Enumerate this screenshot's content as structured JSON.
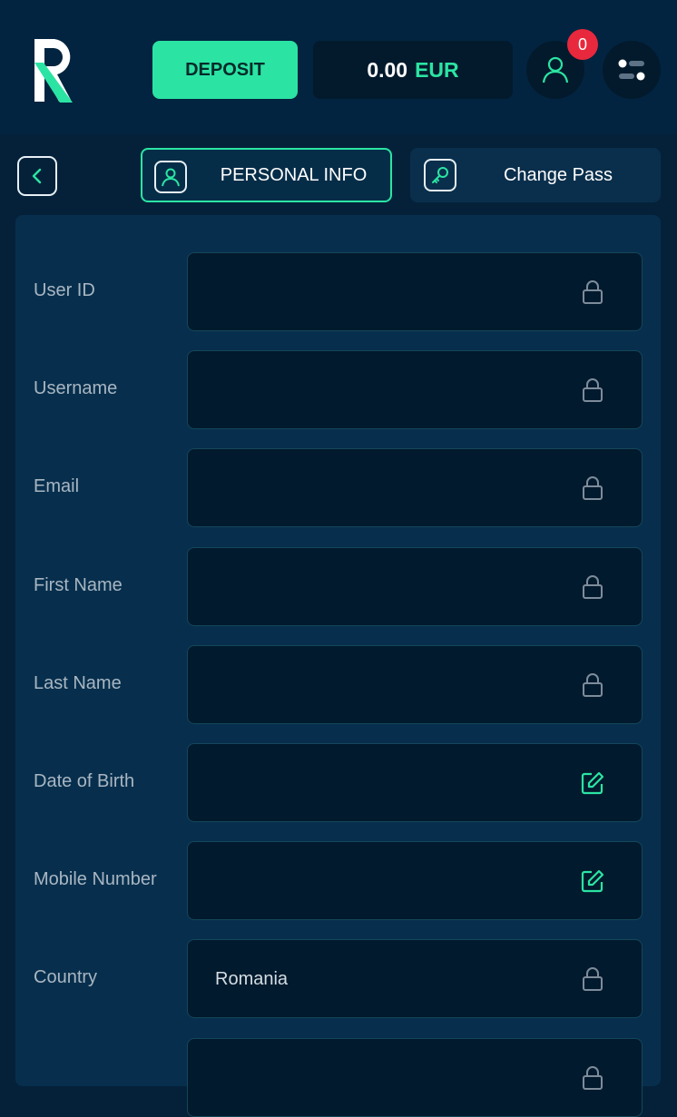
{
  "header": {
    "deposit_label": "DEPOSIT",
    "balance_amount": "0.00",
    "balance_currency": "EUR",
    "notification_count": "0"
  },
  "tabs": [
    {
      "label": "PERSONAL INFO",
      "active": true,
      "icon": "user-card-icon"
    },
    {
      "label": "Change Pass",
      "active": false,
      "icon": "key-icon"
    }
  ],
  "fields": [
    {
      "label": "User ID",
      "value": "",
      "icon": "lock-icon"
    },
    {
      "label": "Username",
      "value": "",
      "icon": "lock-icon"
    },
    {
      "label": "Email",
      "value": "",
      "icon": "lock-icon"
    },
    {
      "label": "First Name",
      "value": "",
      "icon": "lock-icon"
    },
    {
      "label": "Last Name",
      "value": "",
      "icon": "lock-icon"
    },
    {
      "label": "Date of Birth",
      "value": "",
      "icon": "edit-icon"
    },
    {
      "label": "Mobile Number",
      "value": "",
      "icon": "edit-icon"
    },
    {
      "label": "Country",
      "value": "Romania",
      "icon": "lock-icon"
    },
    {
      "label": "",
      "value": "",
      "icon": "lock-icon"
    }
  ],
  "colors": {
    "accent": "#2be4a3",
    "background": "#05213a",
    "badge": "#e8283c"
  }
}
